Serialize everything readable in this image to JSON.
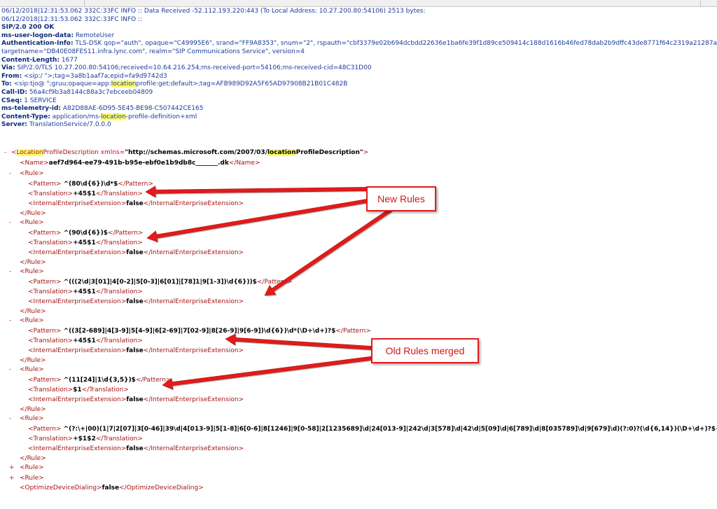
{
  "header": {
    "lines": [
      {
        "text": "06/12/2018|12:31:53.062 332C:33FC INFO  :: Data Received -52.112.193.220:443 (To Local Address: 10.27.200.80:54106) 2513 bytes:",
        "kind": "log"
      },
      {
        "text": "06/12/2018|12:31:53.062 332C:33FC INFO  ::",
        "kind": "log"
      },
      {
        "text": "SIP/2.0 200 OK",
        "kind": "status"
      },
      {
        "key": "ms-user-logon-data:",
        "val": " RemoteUser"
      },
      {
        "key": "Authentication-Info:",
        "val": " TLS-DSK qop=\"auth\", opaque=\"C49995E6\", srand=\"FF9A8353\", snum=\"2\", rspauth=\"cbf3379e02b694dcbdd22636e1ba6fe39f1d89ce509414c188d1616b46fed78dab2b9dffc43de8771f64c2319a21287a\","
      },
      {
        "key": "",
        "val": "targetname=\"DB40E08FES11.infra.lync.com\", realm=\"SIP Communications Service\", version=4"
      },
      {
        "key": "Content-Length:",
        "val": " 1677"
      },
      {
        "key": "Via:",
        "val": " SIP/2.0/TLS 10.27.200.80:54106;received=10.64.216.254;ms-received-port=54106;ms-received-cid=48C31D00"
      },
      {
        "key": "From:",
        "val": " <sip:/          \">;tag=3a8b1aaf7a;epid=fa9d9742d3"
      },
      {
        "key": "To:",
        "val": " <sip:tjo@        \";gruu;opaque=app:",
        "hl": "location",
        "val2": "profile:get;default>;tag=AFB989D92A5F65AD97908B21B01C482B"
      },
      {
        "key": "Call-ID:",
        "val": " 56a4cf9b3a8144c88a3c7ebceeb04809"
      },
      {
        "key": "CSeq:",
        "val": " 1 SERVICE"
      },
      {
        "key": "ms-telemetry-id:",
        "val": " A82D88AE-6D95-5E45-BE98-C507442CE165"
      },
      {
        "key": "Content-Type:",
        "val": " application/ms-",
        "hl": "location",
        "val2": "-profile-definition+xml"
      },
      {
        "key": "Server:",
        "val": " TranslationService/7.0.0.0"
      }
    ]
  },
  "xml": {
    "root_prefix": "-",
    "root_hl": "Location",
    "root_tag": "ProfileDescription",
    "xmlns_attr": "xmlns",
    "xmlns_val_pre": "\"http://schemas.microsoft.com/2007/03/",
    "xmlns_val_hl": "location",
    "xmlns_val_post": "ProfileDescription\"",
    "name_tag": "Name",
    "name_value": "aef7d964-ee79-491b-b95e-ebf0e1b9db8c_______.dk",
    "rule_tag": "Rule",
    "pattern_tag": "Pattern",
    "translation_tag": "Translation",
    "iee_tag": "InternalEnterpriseExtension",
    "rules": [
      {
        "pattern": "^(80\\d{6})\\d*$",
        "translation": "+45$1",
        "iee": "false"
      },
      {
        "pattern": "^(90\\d{6})$",
        "translation": "+45$1",
        "iee": "false"
      },
      {
        "pattern": "^(((2\\d|3[01]|4[0-2]|5[0-3]|6[01]|[78]1|9[1-3])\\d{6}))$",
        "translation": "+45$1",
        "iee": "false"
      },
      {
        "pattern": "^((3[2-689]|4[3-9]|5[4-9]|6[2-69]|7[02-9]|8[26-9]|9[6-9])\\d{6})\\d*(\\D+\\d+)?$",
        "translation": "+45$1",
        "iee": "false"
      },
      {
        "pattern": "^(11[24]|1\\d{3,5})$",
        "translation": "$1",
        "iee": "false"
      },
      {
        "pattern": "^(?:\\+|00)(1|7|2[07]|3[0-46]|39\\d|4[013-9]|5[1-8]|6[0-6]|8[1246]|9[0-58]|2[1235689]\\d|24[013-9]|242\\d|3[578]\\d|42\\d|5[09]\\d|6[789]\\d|8[035789]\\d|9[679]\\d)(?:0)?(\\d{6,14})(\\D+\\d+)?$",
        "translation": "+$1$2",
        "iee": "false"
      }
    ],
    "collapsed_prefix": "+",
    "expanded_prefix": "-",
    "optimize_tag": "OptimizeDeviceDialing",
    "optimize_value": "false"
  },
  "callouts": {
    "new_rules": "New Rules",
    "old_rules": "Old Rules merged"
  },
  "colors": {
    "tag": "#a31515",
    "attr_name": "#e4003a",
    "attr_value": "#0000ff",
    "highlight": "#ffff66",
    "callout_red": "#e21b1b"
  }
}
